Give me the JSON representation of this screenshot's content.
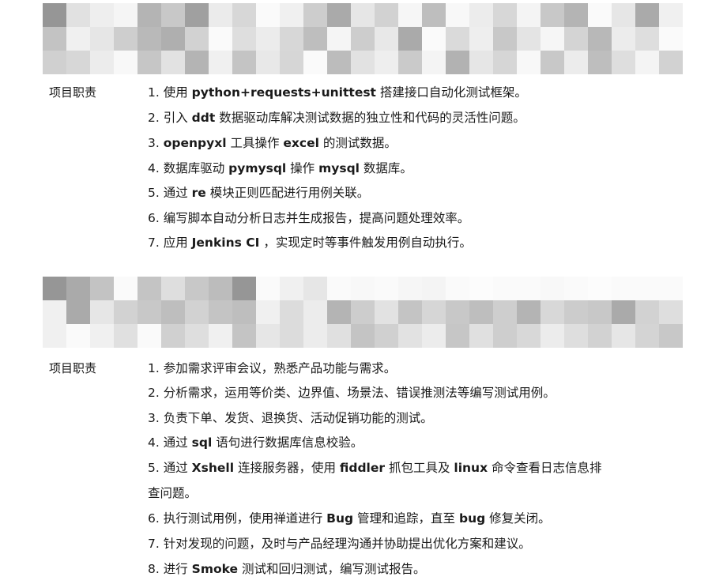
{
  "sections": [
    {
      "label": "项目职责",
      "lines": [
        [
          {
            "t": "1. 使用 "
          },
          {
            "t": "python+requests+unittest",
            "b": true
          },
          {
            "t": " 搭建接口自动化测试框架。"
          }
        ],
        [
          {
            "t": "2. 引入 "
          },
          {
            "t": "ddt",
            "b": true
          },
          {
            "t": " 数据驱动库解决测试数据的独立性和代码的灵活性问题。"
          }
        ],
        [
          {
            "t": "3. "
          },
          {
            "t": "openpyxl",
            "b": true
          },
          {
            "t": " 工具操作 "
          },
          {
            "t": "excel",
            "b": true
          },
          {
            "t": " 的测试数据。"
          }
        ],
        [
          {
            "t": "4. 数据库驱动 "
          },
          {
            "t": "pymysql",
            "b": true
          },
          {
            "t": " 操作 "
          },
          {
            "t": "mysql",
            "b": true
          },
          {
            "t": " 数据库。"
          }
        ],
        [
          {
            "t": "5. 通过 "
          },
          {
            "t": "re",
            "b": true
          },
          {
            "t": " 模块正则匹配进行用例关联。"
          }
        ],
        [
          {
            "t": "6. 编写脚本自动分析日志并生成报告，提高问题处理效率。"
          }
        ],
        [
          {
            "t": "7. 应用 "
          },
          {
            "t": "Jenkins CI",
            "b": true
          },
          {
            "t": " ，实现定时等事件触发用例自动执行。"
          }
        ]
      ]
    },
    {
      "label": "项目职责",
      "lines": [
        [
          {
            "t": "1. 参加需求评审会议，熟悉产品功能与需求。"
          }
        ],
        [
          {
            "t": "2. 分析需求，运用等价类、边界值、场景法、错误推测法等编写测试用例。"
          }
        ],
        [
          {
            "t": "3. 负责下单、发货、退换货、活动促销功能的测试。"
          }
        ],
        [
          {
            "t": "4. 通过 "
          },
          {
            "t": "sql",
            "b": true
          },
          {
            "t": " 语句进行数据库信息校验。"
          }
        ],
        [
          {
            "t": "5. 通过 "
          },
          {
            "t": "Xshell",
            "b": true
          },
          {
            "t": " 连接服务器，使用 "
          },
          {
            "t": "fiddler",
            "b": true
          },
          {
            "t": " 抓包工具及 "
          },
          {
            "t": "linux",
            "b": true
          },
          {
            "t": " 命令查看日志信息排"
          }
        ],
        [
          {
            "t": "查问题。"
          }
        ],
        [
          {
            "t": "6. 执行测试用例，使用禅道进行 "
          },
          {
            "t": "Bug",
            "b": true
          },
          {
            "t": " 管理和追踪，直至 "
          },
          {
            "t": "bug",
            "b": true
          },
          {
            "t": " 修复关闭。"
          }
        ],
        [
          {
            "t": "7. 针对发现的问题，及时与产品经理沟通并协助提出优化方案和建议。"
          }
        ],
        [
          {
            "t": "8. 进行 "
          },
          {
            "t": "Smoke",
            "b": true
          },
          {
            "t": " 测试和回归测试，编写测试报告。"
          }
        ]
      ]
    }
  ]
}
